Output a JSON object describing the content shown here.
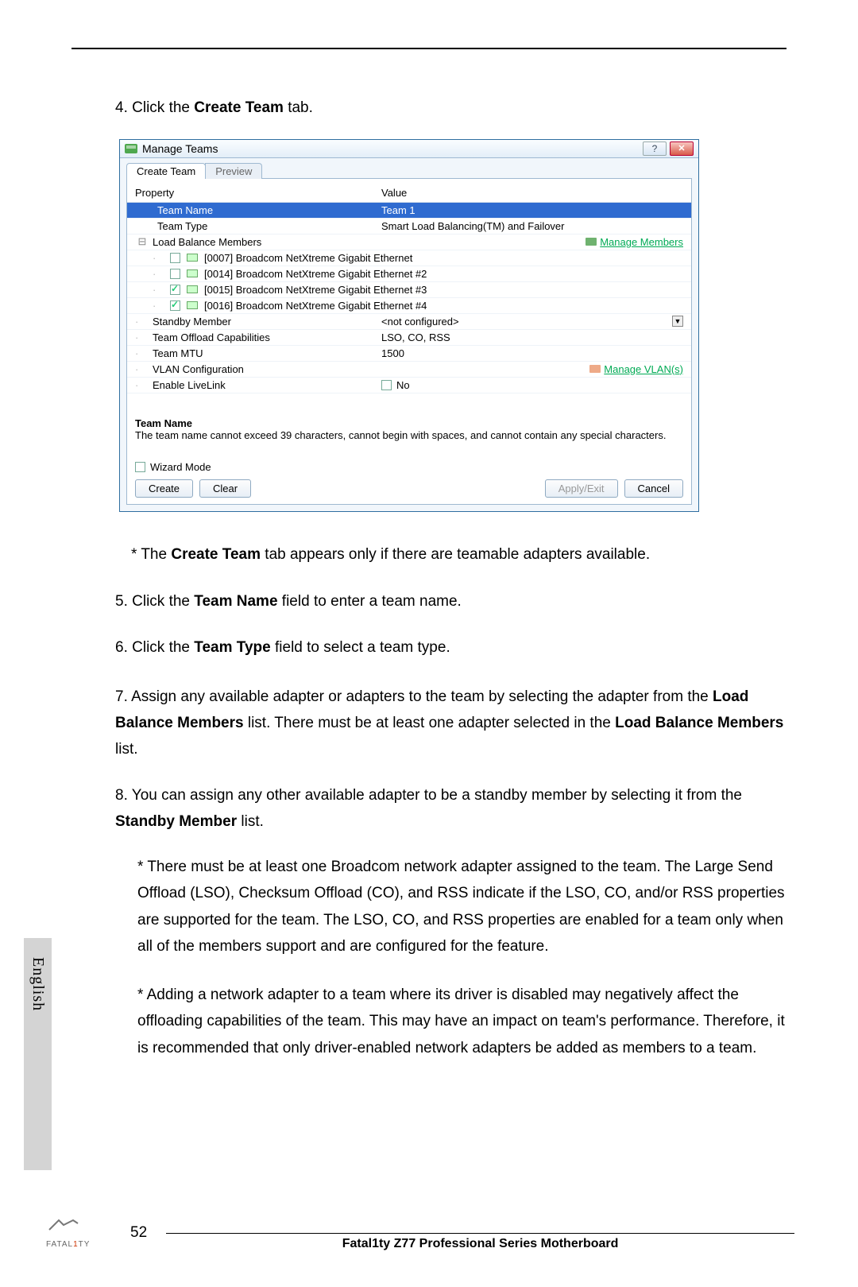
{
  "doc": {
    "step4_prefix": "4. Click the ",
    "step4_bold": "Create Team",
    "step4_suffix": " tab.",
    "note4_prefix": "* The ",
    "note4_bold": "Create Team",
    "note4_suffix": " tab appears only if there are teamable adapters available.",
    "step5_prefix": "5. Click the ",
    "step5_bold": "Team Name",
    "step5_suffix": " field to enter a team name.",
    "step6_prefix": "6. Click the ",
    "step6_bold": "Team Type",
    "step6_suffix": " field to select a team type.",
    "step7_a": "7. Assign any available adapter or adapters to the team by selecting the adapter from the ",
    "step7_b": "Load Balance Members",
    "step7_c": " list. There must be at least one adapter selected in the ",
    "step7_d": "Load Balance Members",
    "step7_e": " list.",
    "step8_a": "8. You can assign any other available adapter to be a standby member by selecting it from the ",
    "step8_b": "Standby Member",
    "step8_c": " list.",
    "note8a": "* There must be at least one Broadcom network adapter assigned to the team. The Large Send Offload (LSO), Checksum Offload (CO), and RSS indicate if the LSO, CO, and/or RSS properties are supported for the team. The LSO, CO, and RSS properties are enabled for a team only when all of the members support and are configured for the feature.",
    "note8b": "* Adding a network adapter to a team where its driver is disabled may negatively affect the offloading capabilities of the team. This may have an impact on team's performance. Therefore, it is recommended that only driver-enabled network adapters be added as members to a team."
  },
  "dialog": {
    "title": "Manage Teams",
    "tabs": {
      "create": "Create Team",
      "preview": "Preview"
    },
    "headers": {
      "property": "Property",
      "value": "Value"
    },
    "rows": {
      "teamName": {
        "label": "Team Name",
        "value": "Team 1"
      },
      "teamType": {
        "label": "Team Type",
        "value": "Smart Load Balancing(TM) and Failover"
      },
      "loadBalance": {
        "label": "Load Balance Members",
        "manage": "Manage Members"
      },
      "members": [
        {
          "checked": false,
          "label": "[0007] Broadcom NetXtreme Gigabit Ethernet"
        },
        {
          "checked": false,
          "label": "[0014] Broadcom NetXtreme Gigabit Ethernet #2"
        },
        {
          "checked": true,
          "label": "[0015] Broadcom NetXtreme Gigabit Ethernet #3"
        },
        {
          "checked": true,
          "label": "[0016] Broadcom NetXtreme Gigabit Ethernet #4"
        }
      ],
      "standby": {
        "label": "Standby Member",
        "value": "<not configured>"
      },
      "offload": {
        "label": "Team Offload Capabilities",
        "value": "LSO, CO, RSS"
      },
      "mtu": {
        "label": "Team MTU",
        "value": "1500"
      },
      "vlan": {
        "label": "VLAN Configuration",
        "manage": "Manage VLAN(s)"
      },
      "livelink": {
        "label": "Enable LiveLink",
        "value": "No"
      }
    },
    "help": {
      "title": "Team Name",
      "desc": "The team name cannot exceed 39 characters, cannot begin with spaces, and cannot contain any special characters."
    },
    "wizard": "Wizard Mode",
    "buttons": {
      "create": "Create",
      "clear": "Clear",
      "apply": "Apply/Exit",
      "cancel": "Cancel"
    }
  },
  "side": {
    "lang": "English"
  },
  "footer": {
    "page": "52",
    "title": "Fatal1ty Z77 Professional Series Motherboard",
    "brand_a": "FATAL",
    "brand_b": "1",
    "brand_c": "TY"
  }
}
